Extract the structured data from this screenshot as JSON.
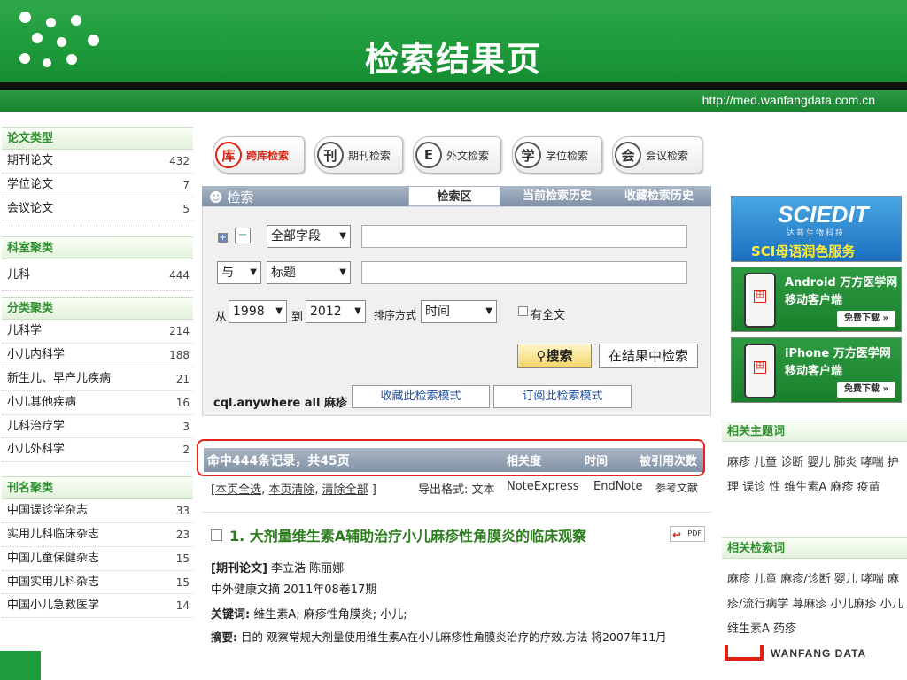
{
  "header": {
    "title": "检索结果页",
    "url": "http://med.wanfangdata.com.cn"
  },
  "facets": [
    {
      "title": "论文类型",
      "items": [
        {
          "label": "期刊论文",
          "count": "432"
        },
        {
          "label": "学位论文",
          "count": "7"
        },
        {
          "label": "会议论文",
          "count": "5"
        }
      ]
    },
    {
      "title": "科室聚类",
      "items": [
        {
          "label": "儿科",
          "count": "444"
        }
      ]
    },
    {
      "title": "分类聚类",
      "items": [
        {
          "label": "儿科学",
          "count": "214"
        },
        {
          "label": "小儿内科学",
          "count": "188"
        },
        {
          "label": "新生儿、早产儿疾病",
          "count": "21"
        },
        {
          "label": "小儿其他疾病",
          "count": "16"
        },
        {
          "label": "儿科治疗学",
          "count": "3"
        },
        {
          "label": "小儿外科学",
          "count": "2"
        }
      ]
    },
    {
      "title": "刊名聚类",
      "items": [
        {
          "label": "中国误诊学杂志",
          "count": "33"
        },
        {
          "label": "实用儿科临床杂志",
          "count": "23"
        },
        {
          "label": "中国儿童保健杂志",
          "count": "15"
        },
        {
          "label": "中国实用儿科杂志",
          "count": "15"
        },
        {
          "label": "中国小儿急救医学",
          "count": "14"
        }
      ]
    }
  ],
  "tabs": [
    {
      "icon": "库",
      "label": "跨库检索"
    },
    {
      "icon": "刊",
      "label": "期刊检索"
    },
    {
      "icon": "E",
      "label": "外文检索"
    },
    {
      "icon": "学",
      "label": "学位检索"
    },
    {
      "icon": "会",
      "label": "会议检索"
    }
  ],
  "search": {
    "label": "检索",
    "subtabs": [
      "检索区",
      "当前检索历史",
      "收藏检索历史"
    ],
    "plus": "+",
    "minus": "−",
    "field1": "全部字段",
    "logic": "与",
    "field2": "标题",
    "from_label": "从",
    "from_year": "1998",
    "to_label": "到",
    "to_year": "2012",
    "sort_label": "排序方式",
    "sort_value": "时间",
    "fulltext_label": "有全文",
    "search_btn": "搜索",
    "refine_btn": "在结果中检索",
    "query": "cql.anywhere all 麻疹",
    "save_mode": "收藏此检索模式",
    "subscribe_mode": "订阅此检索模式"
  },
  "results": {
    "summary": "命中444条记录，共45页",
    "sort_relevance": "相关度",
    "sort_time": "时间",
    "sort_cited": "被引用次数",
    "select_all": "本页全选",
    "clear_page": "本页清除",
    "clear_all": "清除全部",
    "export_label": "导出格式: 文本",
    "export_ne": "NoteExpress",
    "export_en": "EndNote",
    "export_ref": "参考文献",
    "item": {
      "title": "1. 大剂量维生素A辅助治疗小儿麻疹性角膜炎的临床观察",
      "pdf": "PDF",
      "type": "[期刊论文]",
      "authors": "李立浩 陈丽娜",
      "source": "中外健康文摘 2011年08卷17期",
      "kw_label": "关键词:",
      "keywords": "维生素A; 麻疹性角膜炎; 小儿;",
      "abs_label": "摘要:",
      "abstract": "目的 观察常规大剂量使用维生素A在小儿麻疹性角膜炎治疗的疗效.方法 将2007年11月"
    }
  },
  "ads": {
    "scied_big": "SCIEDIT",
    "scied_sub": "达普生物科技",
    "scied_line": "SCI母语润色服务",
    "android_1": "Android 万方医学网",
    "android_2": "移动客户端",
    "iphone_1": "iPhone 万方医学网",
    "iphone_2": "移动客户端",
    "download": "免费下载 »"
  },
  "related_topics": {
    "title": "相关主题词",
    "text": "麻疹  儿童  诊断  婴儿  肺炎  哮喘  护理  误诊  性  维生素A  麻疹  疫苗"
  },
  "related_terms": {
    "title": "相关检索词",
    "text": "麻疹  儿童  麻疹/诊断  婴儿  哮喘  麻疹/流行病学  荨麻疹  小儿麻疹  小儿  维生素A  药疹"
  },
  "logo": {
    "text": "WANFANG DATA"
  },
  "colors": {
    "header_green": "#1d9a3a",
    "facet_green": "#2d8f2d",
    "highlight_red": "#e3231c",
    "link_blue": "#1e4fa8"
  }
}
